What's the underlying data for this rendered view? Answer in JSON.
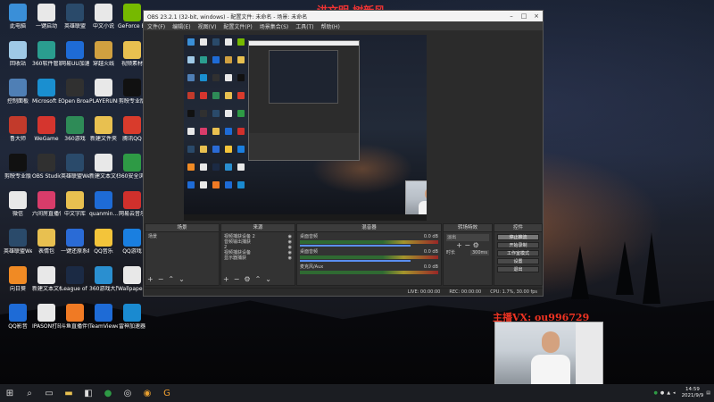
{
  "overlay_title": "讲文明 树新风",
  "desktop_icons": [
    {
      "label": "此电脑",
      "icon": "computer-icon",
      "color": "#3a8fd8"
    },
    {
      "label": "一键启动",
      "icon": "document-icon",
      "color": "#e8e8e8"
    },
    {
      "label": "英雄联盟",
      "icon": "game-icon",
      "color": "#2a4a6a"
    },
    {
      "label": "中文小说",
      "icon": "document-icon",
      "color": "#e8e8e8"
    },
    {
      "label": "GeForce Experience",
      "icon": "nvidia-icon",
      "color": "#76b900"
    },
    {
      "label": "回收站",
      "icon": "recycle-bin-icon",
      "color": "#9fc9e6"
    },
    {
      "label": "360软件管家",
      "icon": "apps-icon",
      "color": "#2a9d8f"
    },
    {
      "label": "网易UU加速器",
      "icon": "speed-icon",
      "color": "#1e6bd6"
    },
    {
      "label": "穿越火线",
      "icon": "game-icon",
      "color": "#d0a040"
    },
    {
      "label": "视频素材",
      "icon": "folder-icon",
      "color": "#e8c050"
    },
    {
      "label": "控制面板",
      "icon": "control-panel-icon",
      "color": "#4f7fb5"
    },
    {
      "label": "Microsoft Edge",
      "icon": "edge-icon",
      "color": "#1a8fd0"
    },
    {
      "label": "Open Broadcast",
      "icon": "obs-icon",
      "color": "#303030"
    },
    {
      "label": "PLAYERUNKNOWN'S BATTLEGROUNDS",
      "icon": "document-icon",
      "color": "#e8e8e8"
    },
    {
      "label": "剪映专业版",
      "icon": "capcut-icon",
      "color": "#111111"
    },
    {
      "label": "鲁大师",
      "icon": "tool-icon",
      "color": "#c23a2b"
    },
    {
      "label": "WeGame",
      "icon": "wegame-icon",
      "color": "#d5352e"
    },
    {
      "label": "360游戏",
      "icon": "game-icon",
      "color": "#2e8b57"
    },
    {
      "label": "新建文件夹",
      "icon": "folder-icon",
      "color": "#e8c050"
    },
    {
      "label": "腾讯QQ",
      "icon": "qq-icon",
      "color": "#d93b2c"
    },
    {
      "label": "剪映专业版",
      "icon": "capcut-icon",
      "color": "#111111"
    },
    {
      "label": "OBS Studio",
      "icon": "obs-icon",
      "color": "#303030"
    },
    {
      "label": "英雄联盟WeGame版",
      "icon": "game-icon",
      "color": "#2a4a6a"
    },
    {
      "label": "新建文本文档",
      "icon": "document-icon",
      "color": "#e8e8e8"
    },
    {
      "label": "360安全浏览器",
      "icon": "browser-icon",
      "color": "#2e9a45"
    },
    {
      "label": "微信",
      "icon": "document-icon",
      "color": "#e8e8e8"
    },
    {
      "label": "六间房直播伴侣",
      "icon": "live-icon",
      "color": "#d83c6a"
    },
    {
      "label": "中文字库",
      "icon": "folder-icon",
      "color": "#e8c050"
    },
    {
      "label": "quanmin...",
      "icon": "app-icon",
      "color": "#1e6bd6"
    },
    {
      "label": "网易云音乐",
      "icon": "music-icon",
      "color": "#d0302c"
    },
    {
      "label": "英雄联盟WeGame版",
      "icon": "game-icon",
      "color": "#2a4a6a"
    },
    {
      "label": "表情包",
      "icon": "folder-icon",
      "color": "#e8c050"
    },
    {
      "label": "一键还原系统",
      "icon": "restore-icon",
      "color": "#2a6bd6"
    },
    {
      "label": "QQ音乐",
      "icon": "music-icon",
      "color": "#f3c43a"
    },
    {
      "label": "QQ游戏",
      "icon": "game-icon",
      "color": "#1a7fe0"
    },
    {
      "label": "向日葵",
      "icon": "sunflower-icon",
      "color": "#f08a24"
    },
    {
      "label": "新建文本文档 (3)",
      "icon": "document-icon",
      "color": "#e8e8e8"
    },
    {
      "label": "League of Legends",
      "icon": "game-icon",
      "color": "#1b2a44"
    },
    {
      "label": "360游戏大厅",
      "icon": "game-icon",
      "color": "#2a8fd0"
    },
    {
      "label": "Wallpaper Engine",
      "icon": "document-icon",
      "color": "#e8e8e8"
    },
    {
      "label": "QQ影音",
      "icon": "video-icon",
      "color": "#1e6bd6"
    },
    {
      "label": "IPASON打印软件",
      "icon": "printer-icon",
      "color": "#e8e8e8"
    },
    {
      "label": "斗鱼直播伴侣",
      "icon": "live-icon",
      "color": "#f07a24"
    },
    {
      "label": "TeamViewer",
      "icon": "teamviewer-icon",
      "color": "#1e6bd6"
    },
    {
      "label": "雷神加速器",
      "icon": "speed-icon",
      "color": "#1a8ad0"
    }
  ],
  "obs": {
    "title": "OBS 23.2.1 (32-bit, windows) - 配置文件: 未命名 - 场景: 未命名",
    "menu": [
      "文件(F)",
      "编辑(E)",
      "视图(V)",
      "配置文件(P)",
      "场景集合(S)",
      "工具(T)",
      "帮助(H)"
    ],
    "docks": {
      "scenes": {
        "header": "场景",
        "items": [
          "场景"
        ]
      },
      "sources": {
        "header": "来源",
        "items": [
          "视频捕获设备 2",
          "音频输出捕获",
          "2",
          "视频捕获设备",
          "显示器捕获"
        ]
      },
      "mixer": {
        "header": "混音器",
        "tracks": [
          {
            "name": "桌面音频",
            "db": "0.0 dB"
          },
          {
            "name": "桌面音频",
            "db": "0.0 dB"
          },
          {
            "name": "麦克风/Aux",
            "db": "0.0 dB"
          }
        ]
      },
      "transitions": {
        "header": "转场特效",
        "type": "淡出",
        "duration_label": "时长",
        "duration": "300ms"
      },
      "controls": {
        "header": "控件",
        "buttons": [
          "停止推流",
          "开始录制",
          "工作室模式",
          "设置",
          "退出"
        ]
      }
    },
    "status": {
      "live": "LIVE: 00:00:00",
      "rec": "REC: 00:00:00",
      "cpu": "CPU: 1.7%, 30.00 fps"
    }
  },
  "webcam_label": "主播VX: ou996729",
  "taskbar": {
    "time": "14:59",
    "date": "2021/9/9",
    "icons": [
      "windows-start-icon",
      "search-icon",
      "task-view-icon",
      "file-explorer-icon",
      "store-icon",
      "browser-icon",
      "obs-icon",
      "chrome-icon",
      "g-app-icon"
    ]
  }
}
